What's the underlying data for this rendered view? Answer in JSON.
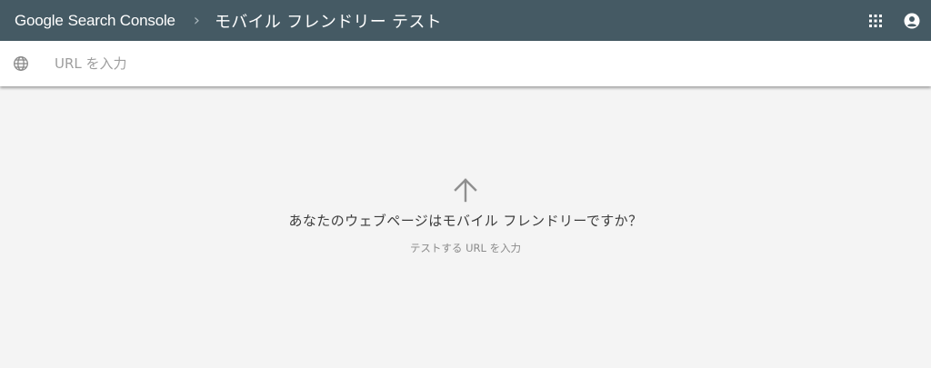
{
  "header": {
    "brand_google": "Google",
    "brand_product": "Search Console",
    "separator": "›",
    "page_title": "モバイル フレンドリー テスト",
    "apps_icon": "apps-grid-icon",
    "account_icon": "account-icon"
  },
  "url_bar": {
    "icon": "globe-icon",
    "value": "",
    "placeholder": "URL を入力"
  },
  "empty_state": {
    "icon": "arrow-up-icon",
    "question": "あなたのウェブページはモバイル フレンドリーですか？",
    "hint": "テストする URL を入力"
  },
  "colors": {
    "header_bg": "#455a64",
    "page_bg": "#f4f4f4"
  }
}
